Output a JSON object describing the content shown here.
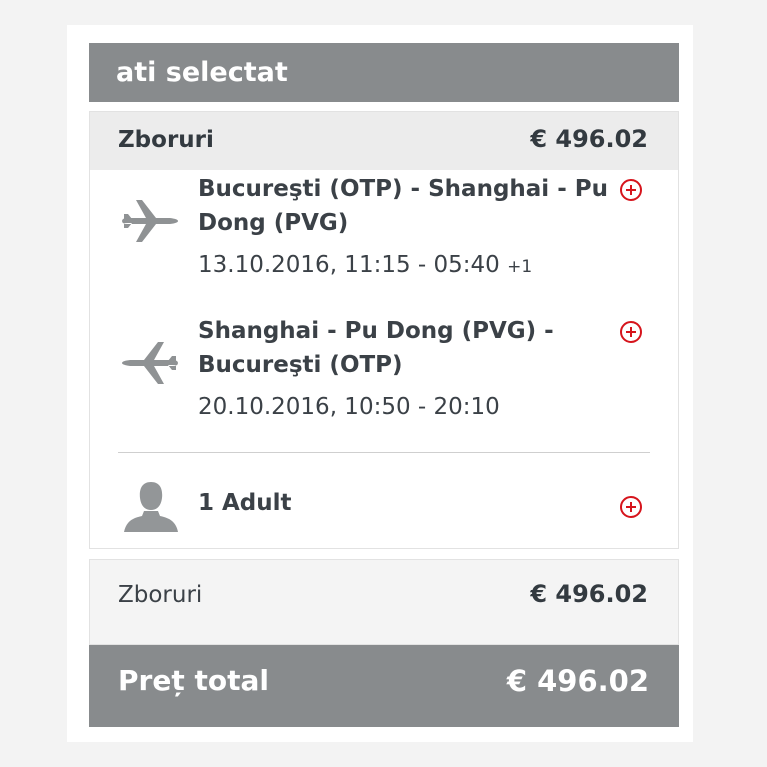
{
  "header": {
    "title": "ati selectat"
  },
  "flights": {
    "label": "Zboruri",
    "amount": "€ 496.02",
    "legs": [
      {
        "route": "Bucureşti (OTP) - Shanghai - Pu Dong (PVG)",
        "times": "13.10.2016, 11:15 - 05:40",
        "day_offset": "+1",
        "icon": "plane-icon"
      },
      {
        "route": "Shanghai - Pu Dong (PVG) - Bucureşti (OTP)",
        "times": "20.10.2016, 10:50 - 20:10",
        "day_offset": "",
        "icon": "plane-icon"
      }
    ],
    "passengers": "1 Adult"
  },
  "summary": {
    "label": "Zboruri",
    "amount": "€ 496.02"
  },
  "total": {
    "label": "Preț total",
    "amount": "€ 496.02"
  },
  "colors": {
    "header_bg": "#888b8d",
    "accent_red": "#d6141c",
    "card_head_bg": "#ececec"
  }
}
